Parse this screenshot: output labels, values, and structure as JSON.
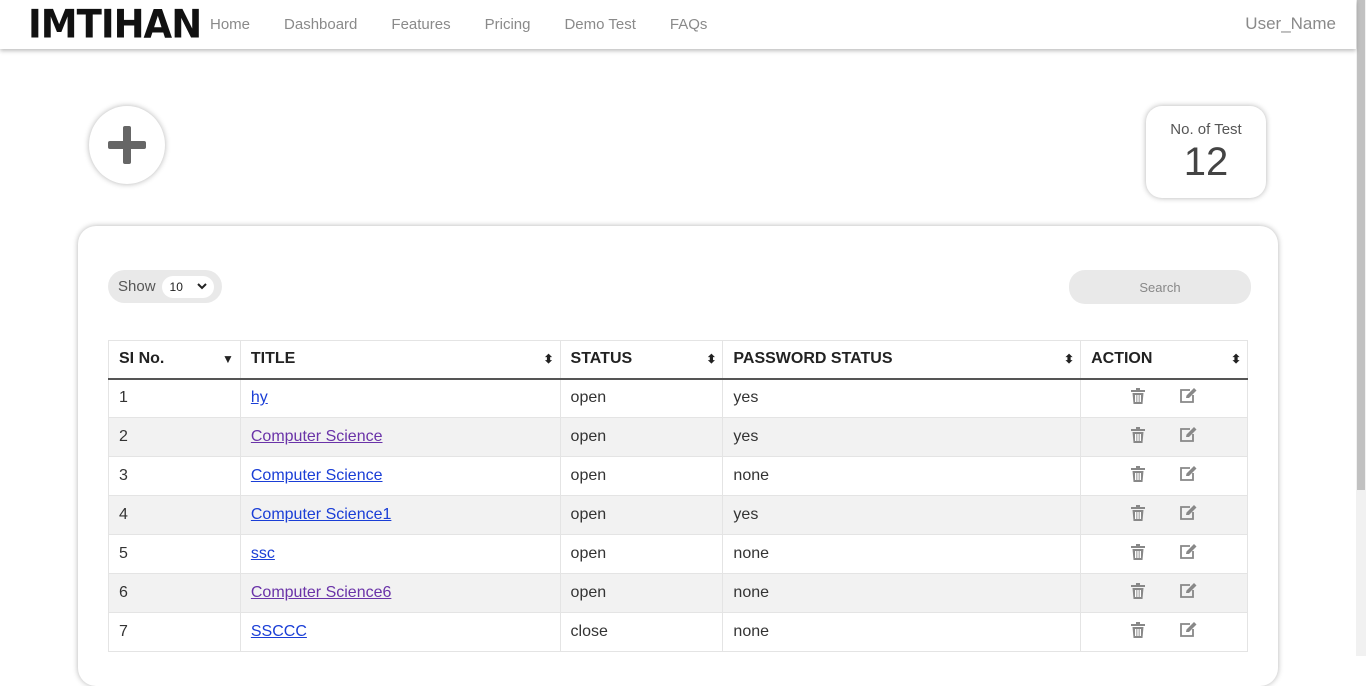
{
  "nav": {
    "logo": "IMTIHAN",
    "links": [
      "Home",
      "Dashboard",
      "Features",
      "Pricing",
      "Demo Test",
      "FAQs"
    ],
    "user": "User_Name"
  },
  "stats": {
    "label": "No. of Test",
    "value": "12"
  },
  "controls": {
    "show_label": "Show",
    "page_size": "10",
    "search_placeholder": "Search"
  },
  "table": {
    "columns": [
      "SI No.",
      "TITLE",
      "STATUS",
      "PASSWORD STATUS",
      "ACTION"
    ],
    "rows": [
      {
        "no": "1",
        "title": "hy",
        "status": "open",
        "password": "yes",
        "visited": false
      },
      {
        "no": "2",
        "title": "Computer Science",
        "status": "open",
        "password": "yes",
        "visited": true
      },
      {
        "no": "3",
        "title": "Computer Science",
        "status": "open",
        "password": "none",
        "visited": false
      },
      {
        "no": "4",
        "title": "Computer Science1",
        "status": "open",
        "password": "yes",
        "visited": false
      },
      {
        "no": "5",
        "title": "ssc",
        "status": "open",
        "password": "none",
        "visited": false
      },
      {
        "no": "6",
        "title": "Computer Science6",
        "status": "open",
        "password": "none",
        "visited": true
      },
      {
        "no": "7",
        "title": "SSCCC",
        "status": "close",
        "password": "none",
        "visited": false
      }
    ]
  },
  "icons": {
    "add": "plus-icon",
    "delete": "trash-icon",
    "edit": "edit-icon",
    "sort": "sort-icon"
  },
  "colors": {
    "link": "#1a3ed6",
    "visited_link": "#6a33a8",
    "pill_bg": "#e9e9e9",
    "nav_text": "#8a8a8a"
  }
}
